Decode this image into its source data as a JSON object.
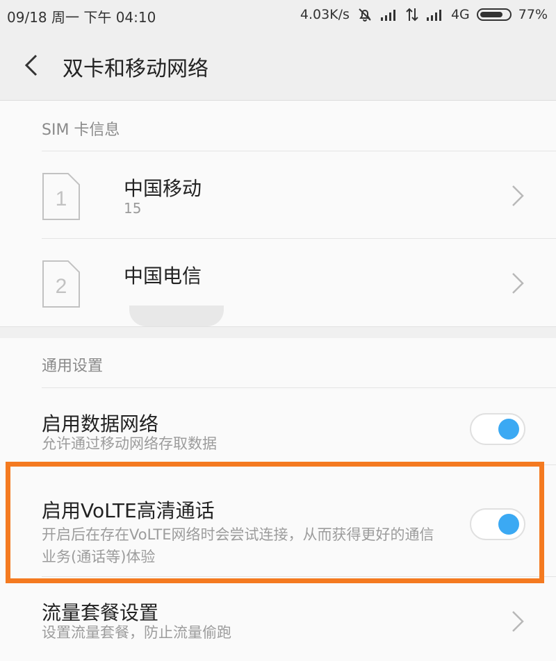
{
  "status_bar": {
    "datetime": "09/18 周一 下午 04:10",
    "net_speed": "4.03K/s",
    "network_type": "4G",
    "battery": "77%"
  },
  "app_bar": {
    "title": "双卡和移动网络"
  },
  "sim_section": {
    "header": "SIM 卡信息",
    "cards": [
      {
        "slot": "1",
        "carrier": "中国移动",
        "number": "15"
      },
      {
        "slot": "2",
        "carrier": "中国电信",
        "number": ""
      }
    ]
  },
  "general_section": {
    "header": "通用设置",
    "settings": [
      {
        "title": "启用数据网络",
        "desc": "允许通过移动网络存取数据",
        "enabled": true
      },
      {
        "title": "启用VoLTE高清通话",
        "desc": "开启后在存在VoLTE网络时会尝试连接，从而获得更好的通信业务(通话等)体验",
        "enabled": true
      },
      {
        "title": "流量套餐设置",
        "desc": "设置流量套餐，防止流量偷跑"
      }
    ]
  },
  "colors": {
    "toggle_on": "#3ba9f3",
    "highlight": "#f47a20"
  }
}
